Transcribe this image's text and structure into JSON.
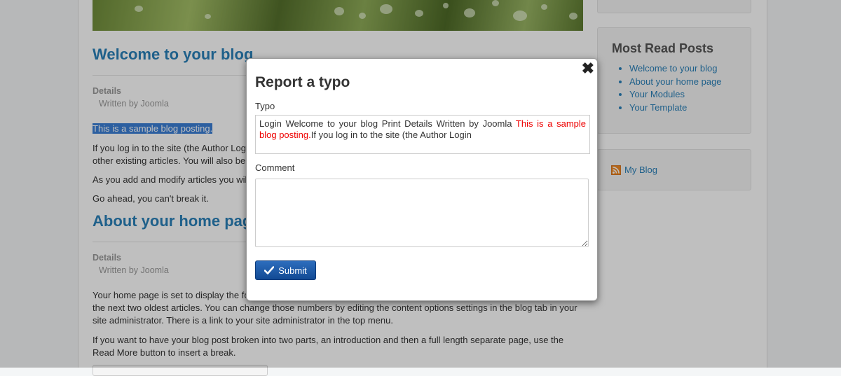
{
  "main": {
    "posts": [
      {
        "title": "Welcome to your blog",
        "details_label": "Details",
        "author": "Written by Joomla",
        "highlighted": "This is a sample blog posting.",
        "paragraphs": [
          "If you log in to the site (the Author Login",
          "other existing articles. You will also be",
          "As you add and modify articles you wil",
          "Go ahead, you can't break it."
        ]
      },
      {
        "title": "About your home pag",
        "details_label": "Details",
        "author": "Written by Joomla",
        "paragraphs": [
          "Your home page is set to display the fo",
          "the next two oldest articles. You can change those numbers by editing the content options settings in the blog tab in your",
          "site administrator. There is a link to your site administrator in the top menu.",
          "If you want to have your blog post broken into two parts, an introduction and then a full length separate page, use the",
          "Read More button to insert a break."
        ]
      }
    ]
  },
  "sidebar": {
    "most_read": {
      "title": "Most Read Posts",
      "items": [
        "Welcome to your blog",
        "About your home page",
        "Your Modules",
        "Your Template"
      ]
    },
    "feed": {
      "label": "My Blog",
      "icon": "rss-icon"
    }
  },
  "modal": {
    "title": "Report a typo",
    "close_glyph": "✖",
    "typo_label": "Typo",
    "typo_before": "Login Welcome to your blog Print Details Written by Joomla ",
    "typo_marked": "This is a sample blog posting.",
    "typo_after": "If you log in to the site (the Author Login",
    "comment_label": "Comment",
    "comment_value": "",
    "submit_label": "Submit",
    "submit_icon": "check-icon"
  },
  "colors": {
    "link": "#2a80b9",
    "typo_mark": "#e00000",
    "submit": "#124a94"
  }
}
